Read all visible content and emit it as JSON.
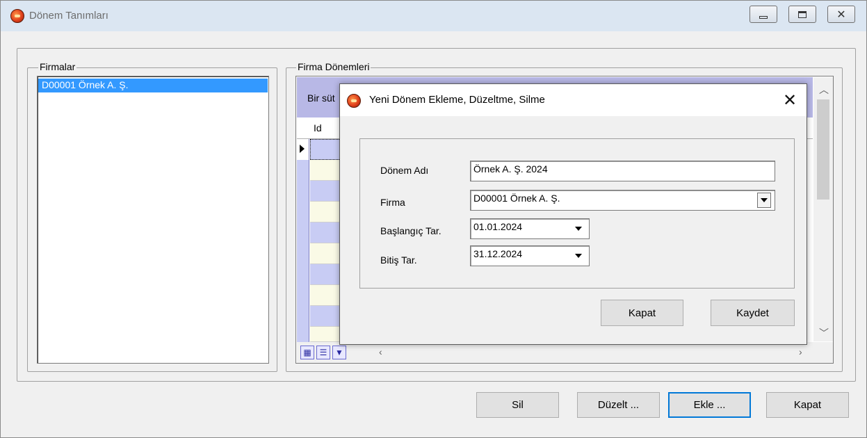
{
  "main_window": {
    "title": "Dönem Tanımları",
    "icon": "app-logo-icon"
  },
  "firmalar": {
    "legend": "Firmalar",
    "items": [
      {
        "label": "D00001  Örnek A. Ş.",
        "selected": true
      }
    ]
  },
  "firma_donemleri": {
    "legend": "Firma Dönemleri",
    "group_panel_text": "Bir süt",
    "columns": [
      "Id"
    ],
    "grid_tool_icons": [
      "export-excel-icon",
      "customize-columns-icon",
      "filter-icon"
    ]
  },
  "footer_buttons": {
    "sil": "Sil",
    "duzelt": "Düzelt ...",
    "ekle": "Ekle ...",
    "kapat": "Kapat"
  },
  "dialog": {
    "title": "Yeni Dönem Ekleme, Düzeltme, Silme",
    "close_glyph": "✕",
    "fields": {
      "donem_adi": {
        "label": "Dönem Adı",
        "value": "Örnek A. Ş. 2024"
      },
      "firma": {
        "label": "Firma",
        "value": "D00001  Örnek A. Ş."
      },
      "baslangic": {
        "label": "Başlangıç Tar.",
        "value": "01.01.2024"
      },
      "bitis": {
        "label": "Bitiş Tar.",
        "value": "31.12.2024"
      }
    },
    "buttons": {
      "kapat": "Kapat",
      "kaydet": "Kaydet"
    }
  },
  "colors": {
    "selection": "#3399ff",
    "grid_band": "#b8b8e6",
    "row_even": "#c8ccf4",
    "row_odd": "#fafae6",
    "default_button_border": "#0078d7"
  }
}
